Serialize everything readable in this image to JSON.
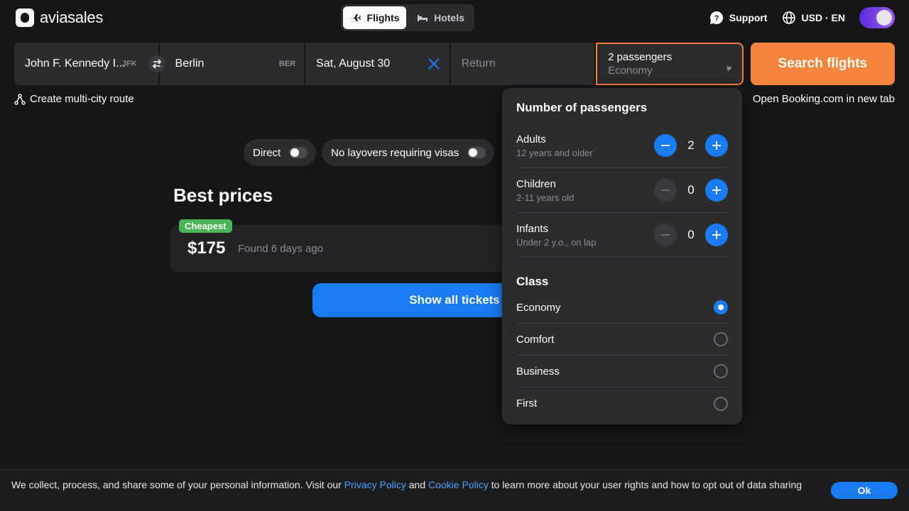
{
  "header": {
    "logo_text": "aviasales",
    "tabs": [
      {
        "label": "Flights",
        "icon": "plane-icon",
        "active": true
      },
      {
        "label": "Hotels",
        "icon": "bed-icon",
        "active": false
      }
    ],
    "support_label": "Support",
    "currency_lang": "USD · EN"
  },
  "search": {
    "from_value": "John F. Kennedy I...",
    "from_code": "JFK",
    "to_value": "Berlin",
    "to_code": "BER",
    "depart_value": "Sat, August 30",
    "return_placeholder": "Return",
    "passengers_line1": "2 passengers",
    "passengers_line2": "Economy",
    "search_button": "Search flights"
  },
  "links": {
    "multicity": "Create multi-city route",
    "booking": "Open Booking.com in new tab"
  },
  "filters": {
    "direct": "Direct",
    "no_visa": "No layovers requiring visas"
  },
  "results": {
    "heading": "Best prices",
    "badge": "Cheapest",
    "price": "$175",
    "found": "Found 6 days ago",
    "show_all": "Show all tickets"
  },
  "dropdown": {
    "title": "Number of passengers",
    "rows": [
      {
        "name": "Adults",
        "sub": "12 years and older",
        "count": "2"
      },
      {
        "name": "Children",
        "sub": "2-11 years old",
        "count": "0"
      },
      {
        "name": "Infants",
        "sub": "Under 2 y.o., on lap",
        "count": "0"
      }
    ],
    "class_title": "Class",
    "classes": [
      "Economy",
      "Comfort",
      "Business",
      "First"
    ],
    "selected_class": "Economy"
  },
  "cookie": {
    "text_before": "We collect, process, and share some of your personal information. Visit our ",
    "privacy_link": "Privacy Policy",
    "and": " and ",
    "cookie_link": "Cookie Policy",
    "text_after": " to learn more about your user rights and how to opt out of data sharing",
    "ok": "Ok"
  },
  "colors": {
    "accent_blue": "#1a7cf5",
    "accent_orange": "#f5843f",
    "badge_green": "#4bb457"
  }
}
